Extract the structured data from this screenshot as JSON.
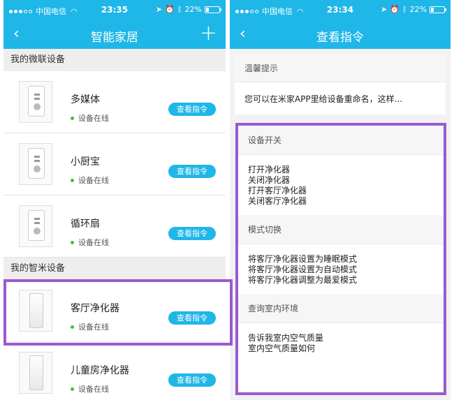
{
  "status_left": {
    "carrier": "中国电信",
    "time": "23:35",
    "battery_percent": 22,
    "battery_label": "22%"
  },
  "status_right": {
    "carrier": "中国电信",
    "time": "23:34",
    "battery_percent": 22,
    "battery_label": "22%"
  },
  "left": {
    "nav": {
      "back": "‹",
      "title": "智能家居",
      "add": "+"
    },
    "sections": [
      {
        "title": "我的微联设备",
        "devices": [
          {
            "name": "多媒体",
            "status": "设备在线",
            "button": "查看指令",
            "kind": "plug"
          },
          {
            "name": "小厨宝",
            "status": "设备在线",
            "button": "查看指令",
            "kind": "plug"
          },
          {
            "name": "循环扇",
            "status": "设备在线",
            "button": "查看指令",
            "kind": "plug"
          }
        ]
      },
      {
        "title": "我的智米设备",
        "devices": [
          {
            "name": "客厅净化器",
            "status": "设备在线",
            "button": "查看指令",
            "kind": "purifier"
          },
          {
            "name": "儿童房净化器",
            "status": "设备在线",
            "button": "查看指令",
            "kind": "purifier"
          }
        ]
      }
    ]
  },
  "right": {
    "nav": {
      "back": "‹",
      "title": "查看指令"
    },
    "tip": {
      "title": "温馨提示",
      "text": "您可以在米家APP里给设备重命名，这样..."
    },
    "groups": [
      {
        "title": "设备开关",
        "items": [
          "打开净化器",
          "关闭净化器",
          "打开客厅净化器",
          "关闭客厅净化器"
        ]
      },
      {
        "title": "模式切换",
        "items": [
          "将客厅净化器设置为睡眠模式",
          "将客厅净化器设置为自动模式",
          "将客厅净化器调整为最爱模式"
        ]
      },
      {
        "title": "查询室内环境",
        "items": [
          "告诉我室内空气质量",
          "室内空气质量如何"
        ]
      }
    ]
  },
  "colors": {
    "accent": "#1fb6e8",
    "highlight": "#9b59d0",
    "online": "#3cc03c"
  }
}
